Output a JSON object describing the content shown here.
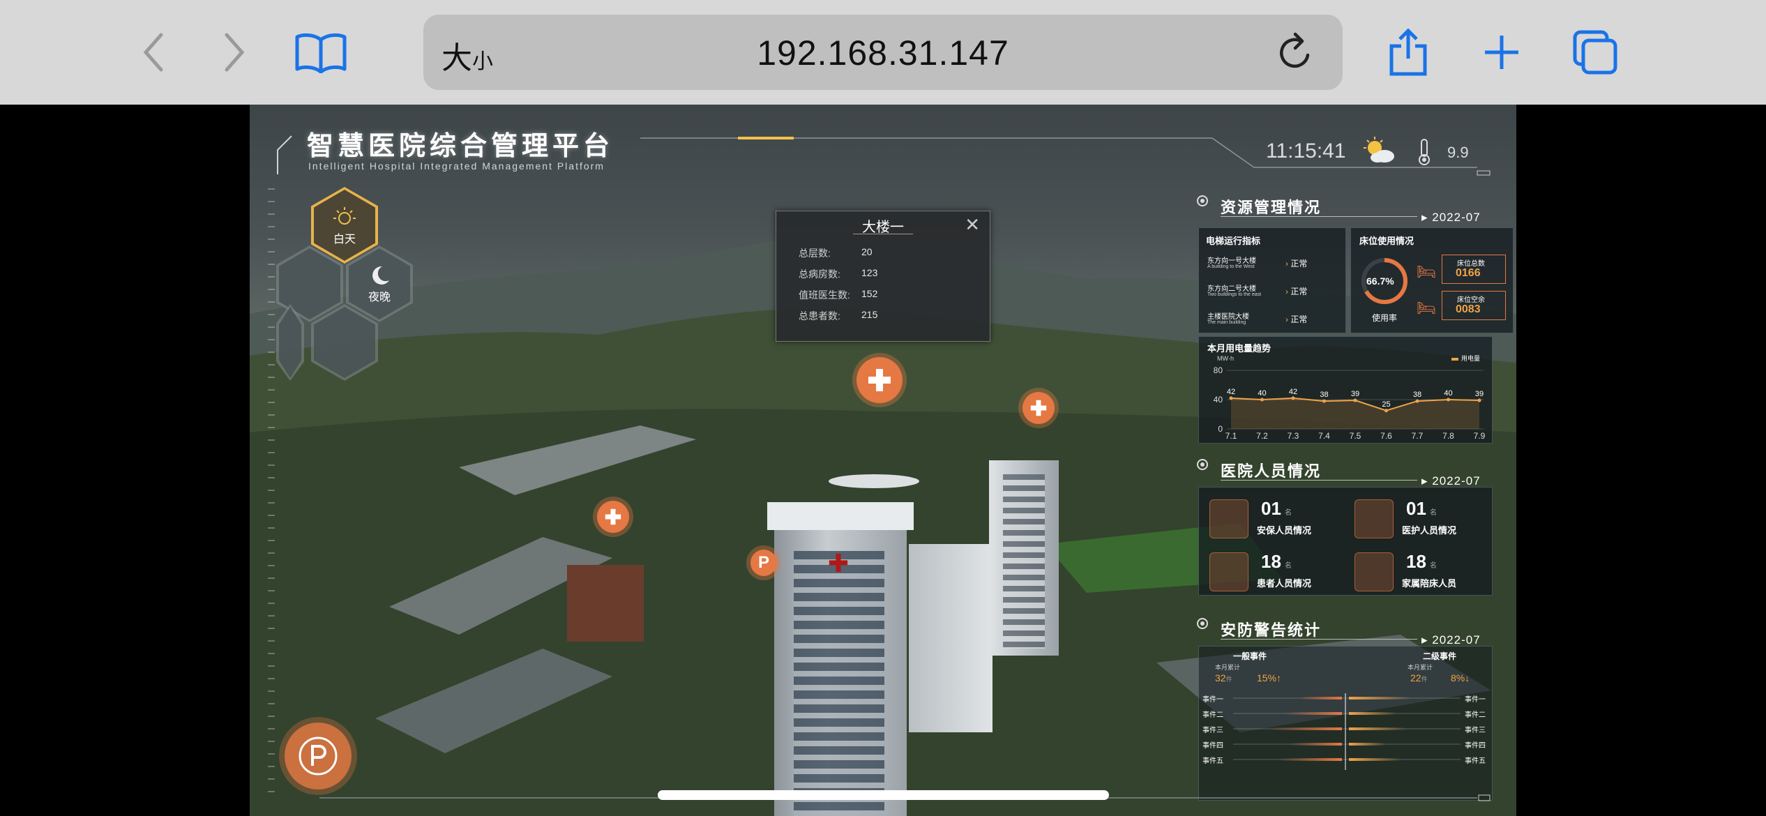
{
  "browser": {
    "text_size_label_big": "大",
    "text_size_label_small": "小",
    "url": "192.168.31.147"
  },
  "dashboard": {
    "title": "智慧医院综合管理平台",
    "subtitle": "Intelligent Hospital Integrated Management Platform",
    "time": "11:15:41",
    "temperature": "9.9",
    "modes": {
      "day": "白天",
      "night": "夜晚"
    }
  },
  "popup": {
    "title": "大楼一",
    "rows": [
      {
        "label": "总层数:",
        "value": "20"
      },
      {
        "label": "总病房数:",
        "value": "123"
      },
      {
        "label": "值班医生数:",
        "value": "152"
      },
      {
        "label": "总患者数:",
        "value": "215"
      }
    ]
  },
  "resources": {
    "heading": "资源管理情况",
    "date": "2022-07",
    "elevator_title": "电梯运行指标",
    "elevators": [
      {
        "name": "东方向一号大楼",
        "name_en": "A building to the West",
        "status": "正常"
      },
      {
        "name": "东方向二号大楼",
        "name_en": "Two buildings to the east",
        "status": "正常"
      },
      {
        "name": "主楼医院大楼",
        "name_en": "The main building",
        "status": "正常"
      }
    ],
    "bed_title": "床位使用情况",
    "usage_rate": "66.7%",
    "usage_rate_value": 66.7,
    "usage_label": "使用率",
    "bed_total_label": "床位总数",
    "bed_total": "0166",
    "bed_free_label": "床位空余",
    "bed_free": "0083"
  },
  "power_chart": {
    "title": "本月用电量趋势",
    "unit": "MW·h",
    "legend": "用电量",
    "chart_data": {
      "type": "line",
      "x": [
        "7.1",
        "7.2",
        "7.3",
        "7.4",
        "7.5",
        "7.6",
        "7.7",
        "7.8",
        "7.9"
      ],
      "series": [
        {
          "name": "用电量",
          "values": [
            42,
            40,
            42,
            38,
            39,
            25,
            38,
            40,
            39
          ]
        }
      ],
      "yticks": [
        0,
        40,
        80
      ],
      "ylim": [
        0,
        80
      ]
    }
  },
  "staff": {
    "heading": "医院人员情况",
    "date": "2022-07",
    "cards": [
      {
        "count": "01",
        "unit": "名",
        "label": "安保人员情况"
      },
      {
        "count": "01",
        "unit": "名",
        "label": "医护人员情况"
      },
      {
        "count": "18",
        "unit": "名",
        "label": "患者人员情况"
      },
      {
        "count": "18",
        "unit": "名",
        "label": "家属陪床人员"
      }
    ]
  },
  "security": {
    "heading": "安防警告统计",
    "date": "2022-07",
    "level1": {
      "label": "一般事件",
      "sub": "本月累计",
      "count": "32",
      "unit": "件",
      "pct": "15%↑"
    },
    "level2": {
      "label": "二级事件",
      "sub": "本月累计",
      "count": "22",
      "unit": "件",
      "pct": "8%↓"
    },
    "events": [
      "事件一",
      "事件二",
      "事件三",
      "事件四",
      "事件五"
    ],
    "left_values": [
      0.4,
      0.55,
      0.7,
      0.5,
      0.6
    ],
    "right_values": [
      0.6,
      0.45,
      0.55,
      0.35,
      0.5
    ]
  },
  "colors": {
    "accent": "#e67843",
    "highlight": "#f0a34a",
    "panel": "#14202a"
  }
}
